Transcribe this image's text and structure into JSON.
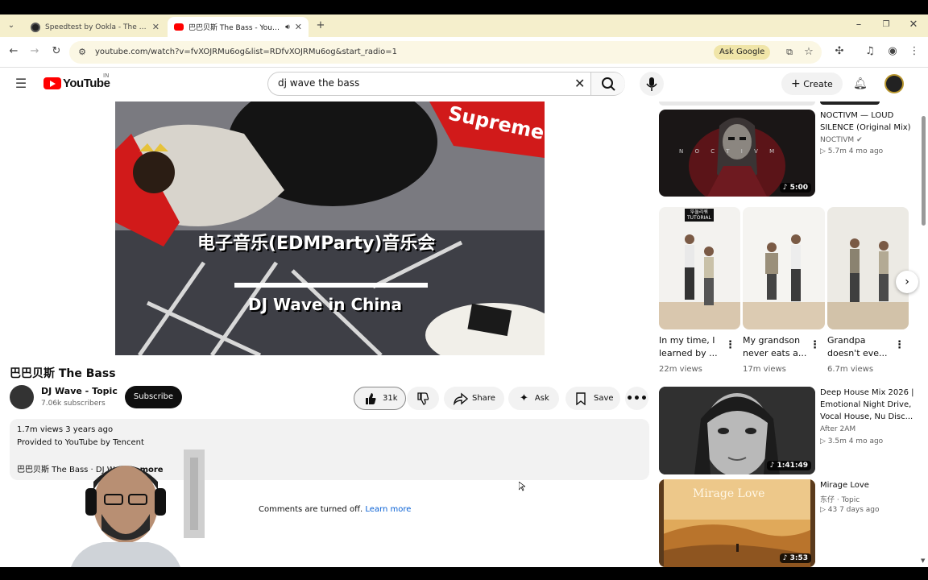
{
  "browser": {
    "tabs": [
      {
        "title": "Speedtest by Ookla - The Global Broadband Speed Test",
        "close": "✕"
      },
      {
        "title": "巴巴贝斯 The Bass - YouTube",
        "close": "✕"
      }
    ],
    "new_tab": "+",
    "url": "youtube.com/watch?v=fvXOJRMu6og&list=RDfvXOJRMu6og&start_radio=1",
    "ask_google": "Ask Google"
  },
  "header": {
    "logo": "YouTube",
    "country": "IN",
    "search_value": "dj wave the bass",
    "create_label": "Create"
  },
  "video": {
    "overlay_title": "电子音乐(EDMParty)音乐会",
    "overlay_subtitle": "DJ Wave in China",
    "brand": "Supreme",
    "title": "巴巴贝斯 The Bass",
    "channel": "DJ Wave - Topic",
    "subscribers": "7.06k subscribers",
    "subscribe_label": "Subscribe",
    "likes": "31k",
    "share_label": "Share",
    "ask_label": "Ask",
    "save_label": "Save",
    "views_date": "1.7m views  3 years ago",
    "provided": "Provided to YouTube by Tencent",
    "desc_line": "巴巴贝斯 The Bass · DJ Wave",
    "desc_more": "...more",
    "comments_off": "Comments are turned off.",
    "learn_more": "Learn more"
  },
  "sidebar": {
    "noctivm": {
      "title": "NOCTIVM — LOUD SILENCE (Original Mix)",
      "channel": "NOCTIVM",
      "meta": "▷ 5.7m  4 mo ago",
      "duration": "♪ 5:00",
      "thumb_text": "N O C T I V M"
    },
    "shorts": [
      {
        "title": "In my time, I learned by ...",
        "views": "22m views",
        "badge_kr": "뚜둘리쿼",
        "badge_en": "TUTORIAL"
      },
      {
        "title": "My grandson never eats a...",
        "views": "17m views"
      },
      {
        "title": "Grandpa doesn't eve...",
        "views": "6.7m views"
      }
    ],
    "deephouse": {
      "title": "Deep House Mix 2026 | Emotional Night Drive, Vocal House, Nu Disc...",
      "channel": "After 2AM",
      "meta": "▷ 3.5m  4 mo ago",
      "duration": "♪ 1:41:49"
    },
    "mirage": {
      "title": "Mirage Love",
      "channel": "东仔 · Topic",
      "meta": "▷ 43  7 days ago",
      "duration": "♪ 3:53",
      "thumb_text": "Mirage Love"
    }
  },
  "colors": {
    "accent_red": "#ff0000",
    "link_blue": "#065fd4",
    "tabstrip": "#f5efcc"
  }
}
